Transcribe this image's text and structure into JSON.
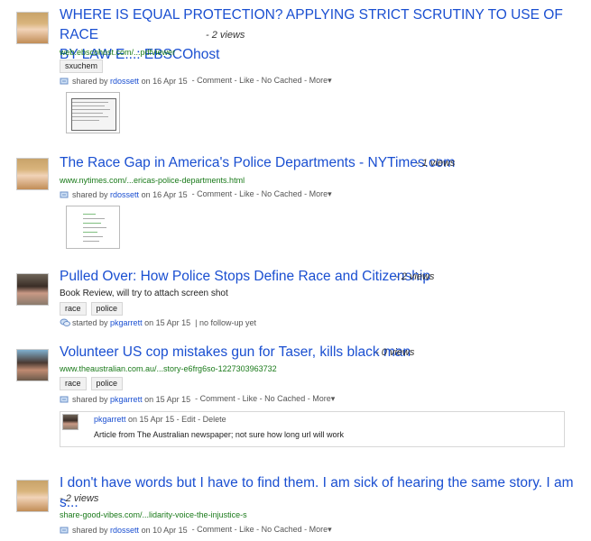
{
  "items": [
    {
      "title_line1": "WHERE IS EQUAL PROTECTION? APPLYING STRICT SCRUTINY TO USE OF RACE",
      "title_line2": "BY LAW E...: EBSCOhost",
      "views": "- 2 views",
      "url": "web.ebscohost.com/...pdfviewer",
      "tags": [
        "sxuchem"
      ],
      "meta": {
        "prefix": "shared by",
        "user": "rdossett",
        "date": "on 16 Apr 15",
        "actions": "- Comment - Like - No Cached - More▾"
      }
    },
    {
      "title": "The Race Gap in America's Police Departments - NYTimes.com",
      "views": "- 1 views",
      "url": "www.nytimes.com/...ericas-police-departments.html",
      "meta": {
        "prefix": "shared by",
        "user": "rdossett",
        "date": "on 16 Apr 15",
        "actions": "- Comment - Like - No Cached - More▾"
      }
    },
    {
      "title": "Pulled Over: How Police Stops Define Race and Citizenship",
      "views": "- 2 views",
      "description": "Book Review, will try to attach screen shot",
      "tags": [
        "race",
        "police"
      ],
      "meta": {
        "prefix": "started by",
        "user": "pkgarrett",
        "date": "on 15 Apr 15",
        "actions": "| no follow-up yet"
      }
    },
    {
      "title": "Volunteer US cop mistakes gun for Taser, kills black man",
      "views": "- 0 views",
      "url": "www.theaustralian.com.au/...story-e6frg6so-1227303963732",
      "tags": [
        "race",
        "police"
      ],
      "meta": {
        "prefix": "shared by",
        "user": "pkgarrett",
        "date": "on 15 Apr 15",
        "actions": "- Comment - Like - No Cached - More▾"
      },
      "comment": {
        "user": "pkgarrett",
        "date": "on 15 Apr 15",
        "actions": "- Edit - Delete",
        "text": "Article from The Australian newspaper; not sure how long url will work"
      }
    },
    {
      "title": "I don't have words but I have to find them. I am sick of hearing the same story. I am s...",
      "views": "- 2 views",
      "url": "share-good-vibes.com/...lidarity-voice-the-injustice-s",
      "meta": {
        "prefix": "shared by",
        "user": "rdossett",
        "date": "on 10 Apr 15",
        "actions": "- Comment - Like - No Cached - More▾"
      }
    }
  ],
  "colors": {
    "link": "#1a4fd1",
    "url": "#1a7a1a",
    "meta": "#555555"
  }
}
